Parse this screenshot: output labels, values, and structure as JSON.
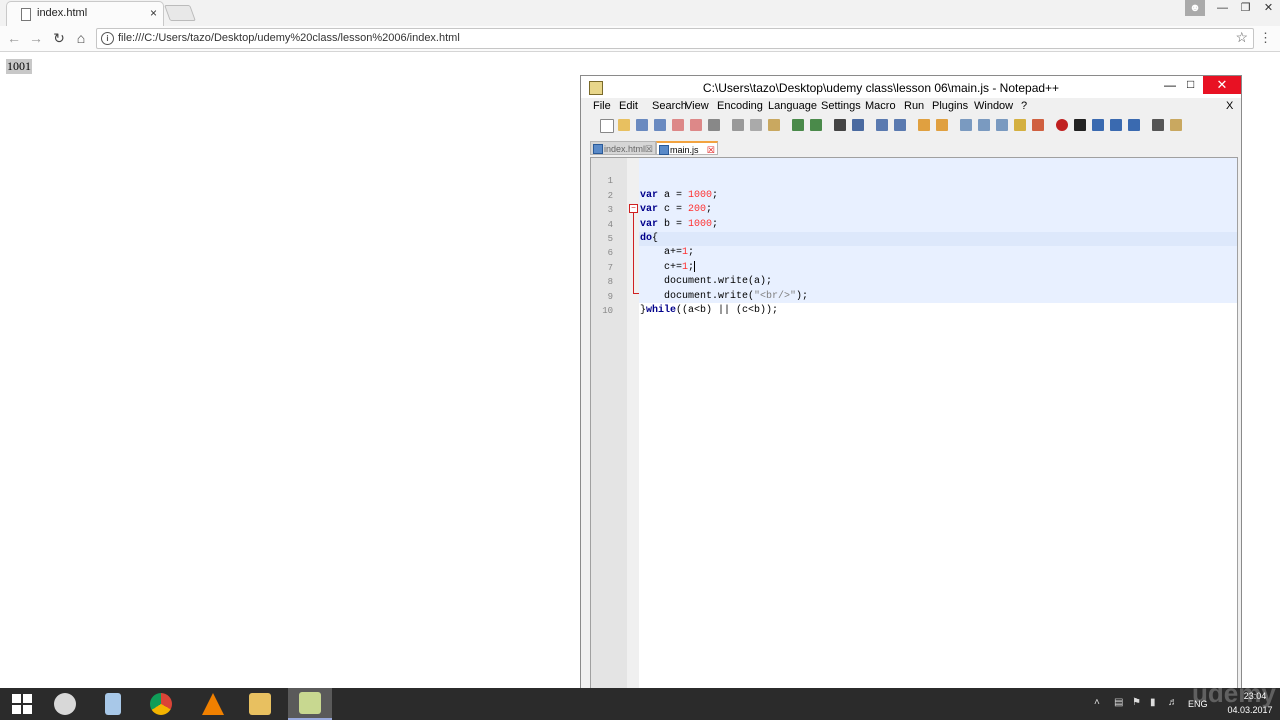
{
  "browser": {
    "tab_title": "index.html",
    "tab_close": "×",
    "url": "file:///C:/Users/tazo/Desktop/udemy%20class/lesson%2006/index.html",
    "page_output": "1001"
  },
  "npp": {
    "title": "C:\\Users\\tazo\\Desktop\\udemy class\\lesson 06\\main.js - Notepad++",
    "menu": [
      "File",
      "Edit",
      "Search",
      "View",
      "Encoding",
      "Language",
      "Settings",
      "Macro",
      "Run",
      "Plugins",
      "Window",
      "?"
    ],
    "menu_close": "X",
    "tabs": [
      {
        "label": "index.html",
        "active": false
      },
      {
        "label": "main.js",
        "active": true
      }
    ],
    "lines": [
      {
        "n": "1",
        "text": "var a = 1000;"
      },
      {
        "n": "2",
        "text": "var c = 200;"
      },
      {
        "n": "3",
        "text": "var b = 1000;"
      },
      {
        "n": "4",
        "text": "do{"
      },
      {
        "n": "5",
        "text": "    a+=1;"
      },
      {
        "n": "6",
        "text": "    c+=1;"
      },
      {
        "n": "7",
        "text": "    document.write(a);"
      },
      {
        "n": "8",
        "text": "    document.write(\"<br/>\");"
      },
      {
        "n": "9",
        "text": "}while((a<b) || (c<b));"
      },
      {
        "n": "10",
        "text": ""
      }
    ]
  },
  "taskbar": {
    "lang": "ENG",
    "time": "23:04",
    "date": "04.03.2017",
    "watermark": "udemy"
  },
  "colors": {
    "keyword": "#00008b",
    "number": "#ff3030",
    "string": "#808080",
    "close_red": "#e81123"
  }
}
